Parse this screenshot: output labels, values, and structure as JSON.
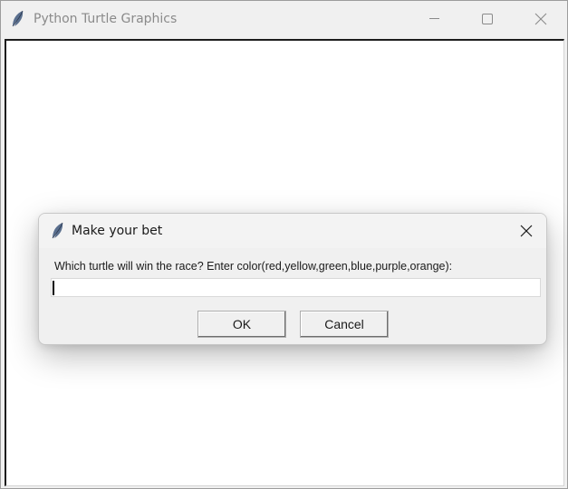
{
  "window": {
    "title": "Python Turtle Graphics",
    "icon": "feather-icon",
    "controls": [
      "minimize-icon",
      "maximize-icon",
      "close-icon"
    ]
  },
  "dialog": {
    "title": "Make your bet",
    "icon": "feather-icon",
    "prompt": "Which turtle will win the race? Enter color(red,yellow,green,blue,purple,orange):",
    "input_value": "",
    "ok_label": "OK",
    "cancel_label": "Cancel"
  },
  "colors": {
    "window_bg": "#f0f0f0",
    "canvas_bg": "#ffffff",
    "title_text_inactive": "#8a8a8a",
    "text": "#1a1a1a"
  }
}
